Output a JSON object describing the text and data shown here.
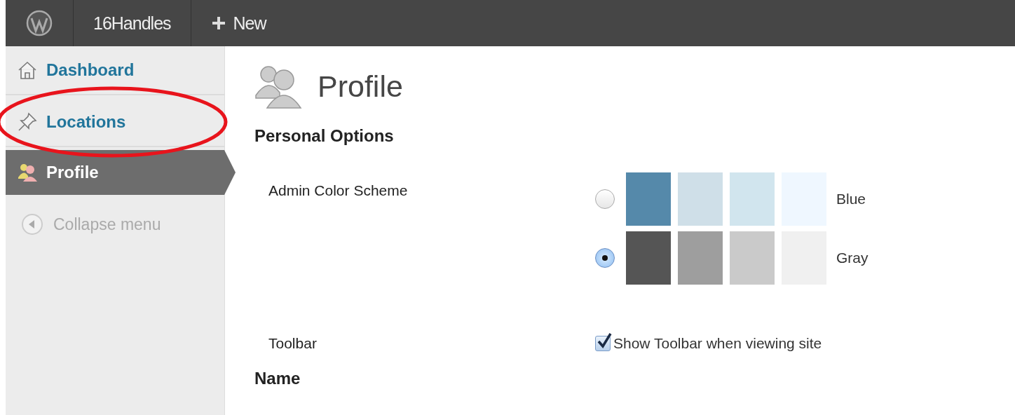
{
  "admin_bar": {
    "site_name": "16Handles",
    "new_label": "New"
  },
  "sidebar": {
    "items": [
      {
        "label": "Dashboard",
        "kind": "home",
        "selected": false
      },
      {
        "label": "Locations",
        "kind": "pin",
        "selected": false
      },
      {
        "label": "Profile",
        "kind": "users",
        "selected": true
      }
    ],
    "collapse_label": "Collapse menu"
  },
  "page": {
    "title": "Profile",
    "section": "Personal Options",
    "color_scheme": {
      "label": "Admin Color Scheme",
      "options": [
        {
          "name": "Blue",
          "selected": false,
          "swatches": [
            {
              "color": "#5589aa"
            },
            {
              "color": "#cfdfe8"
            },
            {
              "color": "#d1e5ee"
            },
            {
              "color": "#eff7ff"
            }
          ]
        },
        {
          "name": "Gray",
          "selected": true,
          "swatches": [
            {
              "color": "#555555"
            },
            {
              "color": "#9e9e9e"
            },
            {
              "color": "#cacaca"
            },
            {
              "color": "#f0f0f0"
            }
          ]
        }
      ]
    },
    "toolbar": {
      "label": "Toolbar",
      "checkbox_label": "Show Toolbar when viewing site",
      "checked": true
    },
    "next_section": "Name"
  }
}
